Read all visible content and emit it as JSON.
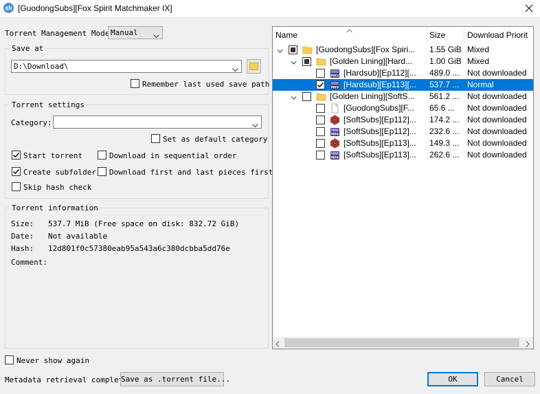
{
  "window": {
    "title": "[GuodongSubs][Fox Spirit Matchmaker IX]",
    "app_icon_text": "qb"
  },
  "management": {
    "label": "Torrent Management Mode:",
    "value": "Manual"
  },
  "save_at": {
    "title": "Save at",
    "path": "D:\\Download\\",
    "remember_label": "Remember last used save path",
    "remember_checked": false
  },
  "settings": {
    "title": "Torrent settings",
    "category_label": "Category:",
    "category_value": "",
    "default_category_label": "Set as default category",
    "start_torrent_label": "Start torrent",
    "start_torrent_checked": true,
    "sequential_label": "Download in sequential order",
    "create_subfolder_label": "Create subfolder",
    "create_subfolder_checked": true,
    "first_last_label": "Download first and last pieces first",
    "skip_hash_label": "Skip hash check"
  },
  "info": {
    "title": "Torrent information",
    "size_label": "Size:",
    "size_value": "537.7 MiB (Free space on disk: 832.72 GiB)",
    "date_label": "Date:",
    "date_value": "Not available",
    "hash_label": "Hash:",
    "hash_value": "12d801f0c57380eab95a543a6c380dcbba5dd76e",
    "comment_label": "Comment:",
    "comment_value": ""
  },
  "tree": {
    "columns": [
      "Name",
      "Size",
      "Download Priorit"
    ],
    "rows": [
      {
        "depth": 0,
        "expander": "expanded",
        "check": "partial",
        "icon": "folder-icon",
        "name": "[GuodongSubs][Fox Spiri...",
        "size": "1.55 GiB",
        "priority": "Mixed"
      },
      {
        "depth": 1,
        "expander": "expanded",
        "check": "partial",
        "icon": "folder-icon",
        "name": "[Golden Lining][Hard...",
        "size": "1.00 GiB",
        "priority": "Mixed"
      },
      {
        "depth": 2,
        "expander": "none",
        "check": "unchecked",
        "icon": "mkv-file-icon",
        "name": "[Hardsub][Ep112][...",
        "size": "489.0 ...",
        "priority": "Not downloaded"
      },
      {
        "depth": 2,
        "expander": "none",
        "check": "checked",
        "icon": "mkv-file-icon",
        "name": "[Hardsub][Ep113][...",
        "size": "537.7 ...",
        "priority": "Normal",
        "selected": true
      },
      {
        "depth": 1,
        "expander": "expanded",
        "check": "unchecked",
        "icon": "folder-icon",
        "name": "[Golden Lining][SoftS...",
        "size": "561.2 ...",
        "priority": "Not downloaded"
      },
      {
        "depth": 2,
        "expander": "none",
        "check": "unchecked",
        "icon": "file-icon",
        "name": "[GuodongSubs][F...",
        "size": "65.6 ...",
        "priority": "Not downloaded"
      },
      {
        "depth": 2,
        "expander": "none",
        "check": "unchecked",
        "icon": "media-file-icon",
        "name": "[SoftSubs][Ep112]...",
        "size": "174.2 ...",
        "priority": "Not downloaded"
      },
      {
        "depth": 2,
        "expander": "none",
        "check": "unchecked",
        "icon": "mp4-file-icon",
        "name": "[SoftSubs][Ep112]...",
        "size": "232.6 ...",
        "priority": "Not downloaded"
      },
      {
        "depth": 2,
        "expander": "none",
        "check": "unchecked",
        "icon": "media-file-icon",
        "name": "[SoftSubs][Ep113]...",
        "size": "149.3 ...",
        "priority": "Not downloaded"
      },
      {
        "depth": 2,
        "expander": "none",
        "check": "unchecked",
        "icon": "mp4-file-icon",
        "name": "[SoftSubs][Ep113]...",
        "size": "262.6 ...",
        "priority": "Not downloaded"
      }
    ]
  },
  "footer": {
    "never_show_label": "Never show again",
    "status": "Metadata retrieval complete",
    "save_torrent_label": "Save as .torrent file...",
    "ok_label": "OK",
    "cancel_label": "Cancel"
  },
  "colors": {
    "selection": "#0078d7",
    "folder": "#f5cf5c",
    "window_bg": "#f0f0f0"
  }
}
